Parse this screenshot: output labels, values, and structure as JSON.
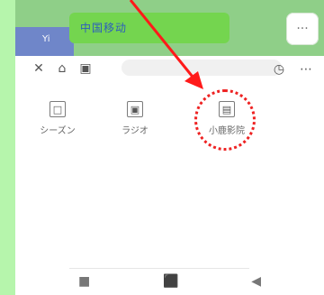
{
  "colors": {
    "backdrop": "#b6f5ac",
    "status_bar": "#8fcf88",
    "status_left": "#6f86c9",
    "title_pill": "#74d54f",
    "annotation": "#e22"
  },
  "status_bar": {
    "title": "中国移动",
    "left_text": "Yi",
    "menu": "···"
  },
  "toolbar": {
    "back_icon": "close-icon",
    "home_icon": "home-icon",
    "image_icon": "image-icon",
    "clock_icon": "clock-icon",
    "more_icon": "more-icon"
  },
  "apps": [
    {
      "icon": "app-icon-1",
      "label": "シーズン"
    },
    {
      "icon": "app-icon-2",
      "label": "ラジオ"
    },
    {
      "icon": "app-icon-3",
      "label": "小鹿影院"
    }
  ],
  "bottom_nav": [
    {
      "icon": "menu-icon"
    },
    {
      "icon": "home-icon"
    },
    {
      "icon": "back-icon"
    }
  ]
}
